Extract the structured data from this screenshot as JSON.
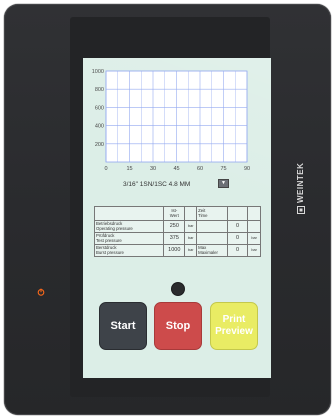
{
  "device": {
    "brand": "WEINTEK"
  },
  "chart_data": {
    "type": "line",
    "x_ticks": [
      0,
      15,
      30,
      45,
      60,
      75,
      90
    ],
    "y_ticks": [
      200,
      400,
      600,
      800,
      1000
    ],
    "xlim": [
      0,
      90
    ],
    "ylim": [
      0,
      1000
    ],
    "grid": true,
    "series": []
  },
  "selector": {
    "value": "3/16\" 1SN/1SC 4.8 MM",
    "arrow_icon": "triangle-down-icon"
  },
  "table": {
    "header": {
      "col1": "Ist-\nWert",
      "col2": "Zeit\nTime"
    },
    "rows": [
      {
        "label": "Betriebsdruck\nOperating pressure",
        "value": "250",
        "unit": "bar",
        "time_label": "Zeit\nTime",
        "time_value": "0",
        "time_unit": ""
      },
      {
        "label": "Prüfdruck\nTest pressure",
        "value": "375",
        "unit": "bar",
        "time_label": "",
        "time_value": "0",
        "time_unit": "bar"
      },
      {
        "label": "Berstdruck\nBurst pressure",
        "value": "1000",
        "unit": "bar",
        "time_label": "Max\nMaximaler",
        "time_value": "0",
        "time_unit": "bar"
      }
    ]
  },
  "buttons": {
    "start": "Start",
    "stop": "Stop",
    "print": "Print\nPreview"
  },
  "colors": {
    "screen_bg": "#dceee7",
    "grid": "#8fa6f0",
    "start": "#3e4349",
    "stop": "#cd4b4b",
    "print": "#e9ec64",
    "power_led": "#ff6a1a"
  }
}
